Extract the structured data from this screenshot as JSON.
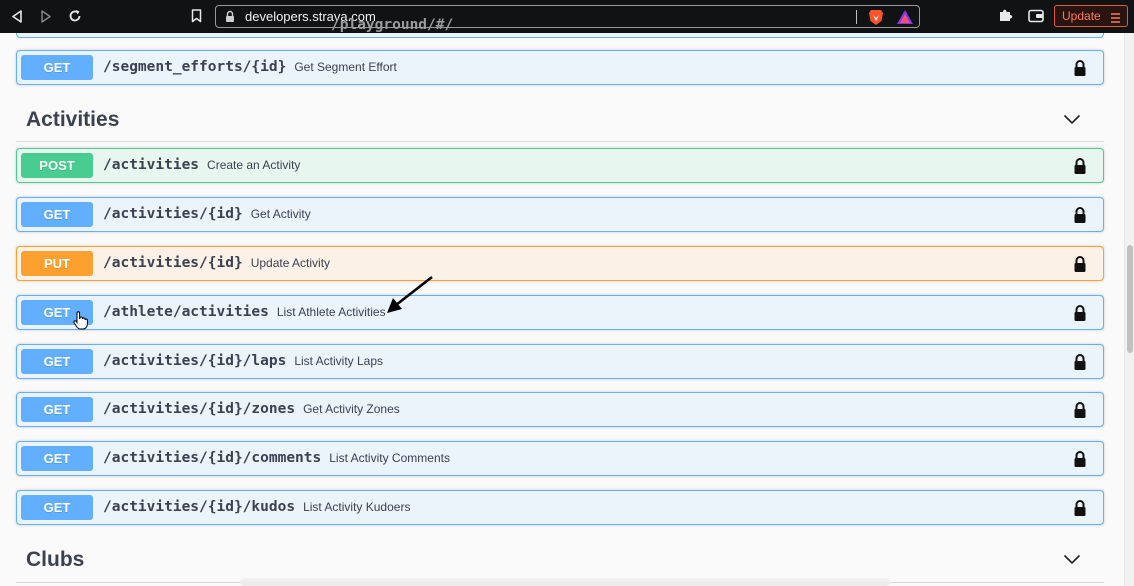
{
  "browser": {
    "url_host": "developers.strava.com",
    "url_path": "/playground/#/",
    "update_label": "Update"
  },
  "colors": {
    "get": "#61affe",
    "post": "#49cc90",
    "put": "#fca130"
  },
  "operations_above": [
    {
      "method": "GET",
      "path": "/segment_efforts/{id}",
      "summary": "Get Segment Effort"
    }
  ],
  "sections": {
    "activities": {
      "title": "Activities",
      "operations": [
        {
          "method": "POST",
          "path": "/activities",
          "summary": "Create an Activity"
        },
        {
          "method": "GET",
          "path": "/activities/{id}",
          "summary": "Get Activity"
        },
        {
          "method": "PUT",
          "path": "/activities/{id}",
          "summary": "Update Activity"
        },
        {
          "method": "GET",
          "path": "/athlete/activities",
          "summary": "List Athlete Activities"
        },
        {
          "method": "GET",
          "path": "/activities/{id}/laps",
          "summary": "List Activity Laps"
        },
        {
          "method": "GET",
          "path": "/activities/{id}/zones",
          "summary": "Get Activity Zones"
        },
        {
          "method": "GET",
          "path": "/activities/{id}/comments",
          "summary": "List Activity Comments"
        },
        {
          "method": "GET",
          "path": "/activities/{id}/kudos",
          "summary": "List Activity Kudoers"
        }
      ]
    },
    "clubs": {
      "title": "Clubs"
    }
  },
  "icons": {
    "back": "back-arrow-icon",
    "forward": "forward-arrow-icon",
    "reload": "reload-icon",
    "bookmark": "bookmark-icon",
    "lock": "lock-icon",
    "chevron": "chevron-down-icon",
    "cursor": "hand-pointer-icon",
    "annotation": "arrow-annotation-icon"
  }
}
